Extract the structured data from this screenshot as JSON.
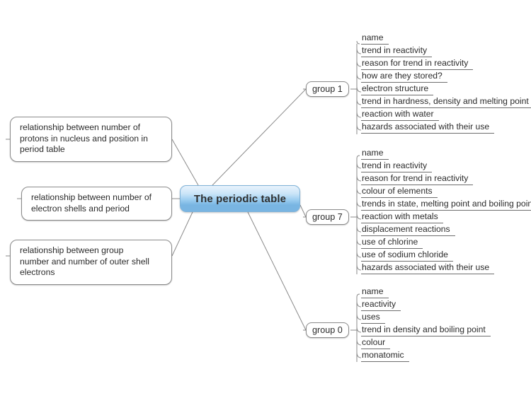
{
  "diagram": {
    "type": "mind-map",
    "title": "The periodic table",
    "background_color": "#ffffff",
    "central_node": {
      "label": "The periodic table",
      "fill_top_color": "#e8f3fc",
      "fill_bottom_color": "#79b5e2",
      "border_color": "#7fb2d8"
    },
    "left_topics": [
      {
        "id": "protons-position",
        "lines": [
          "relationship between number of",
          "protons in nucleus and position in",
          "period table"
        ]
      },
      {
        "id": "shells-period",
        "lines": [
          "relationship between number of",
          "electron shells and period"
        ]
      },
      {
        "id": "group-outer-electrons",
        "lines": [
          "relationship between group",
          "number and number of outer shell",
          "electrons"
        ]
      }
    ],
    "branches": [
      {
        "id": "group-1",
        "label": "group 1",
        "leaves": [
          "name",
          "trend in reactivity",
          "reason for trend in reactivity",
          "how are they stored?",
          "electron structure",
          "trend in hardness, density and melting point",
          "reaction with water",
          "hazards associated with their use"
        ]
      },
      {
        "id": "group-7",
        "label": "group 7",
        "leaves": [
          "name",
          "trend in reactivity",
          "reason for trend in reactivity",
          "colour of elements",
          "trends in state, melting point and boiling point",
          "reaction with metals",
          "displacement reactions",
          "use of chlorine",
          "use of sodium chloride",
          "hazards associated with their use"
        ]
      },
      {
        "id": "group-0",
        "label": "group 0",
        "leaves": [
          "name",
          "reactivity",
          "uses",
          "trend in density and boiling point",
          "colour",
          "monatomic"
        ]
      }
    ],
    "connector_color": "#8a8a8a"
  }
}
